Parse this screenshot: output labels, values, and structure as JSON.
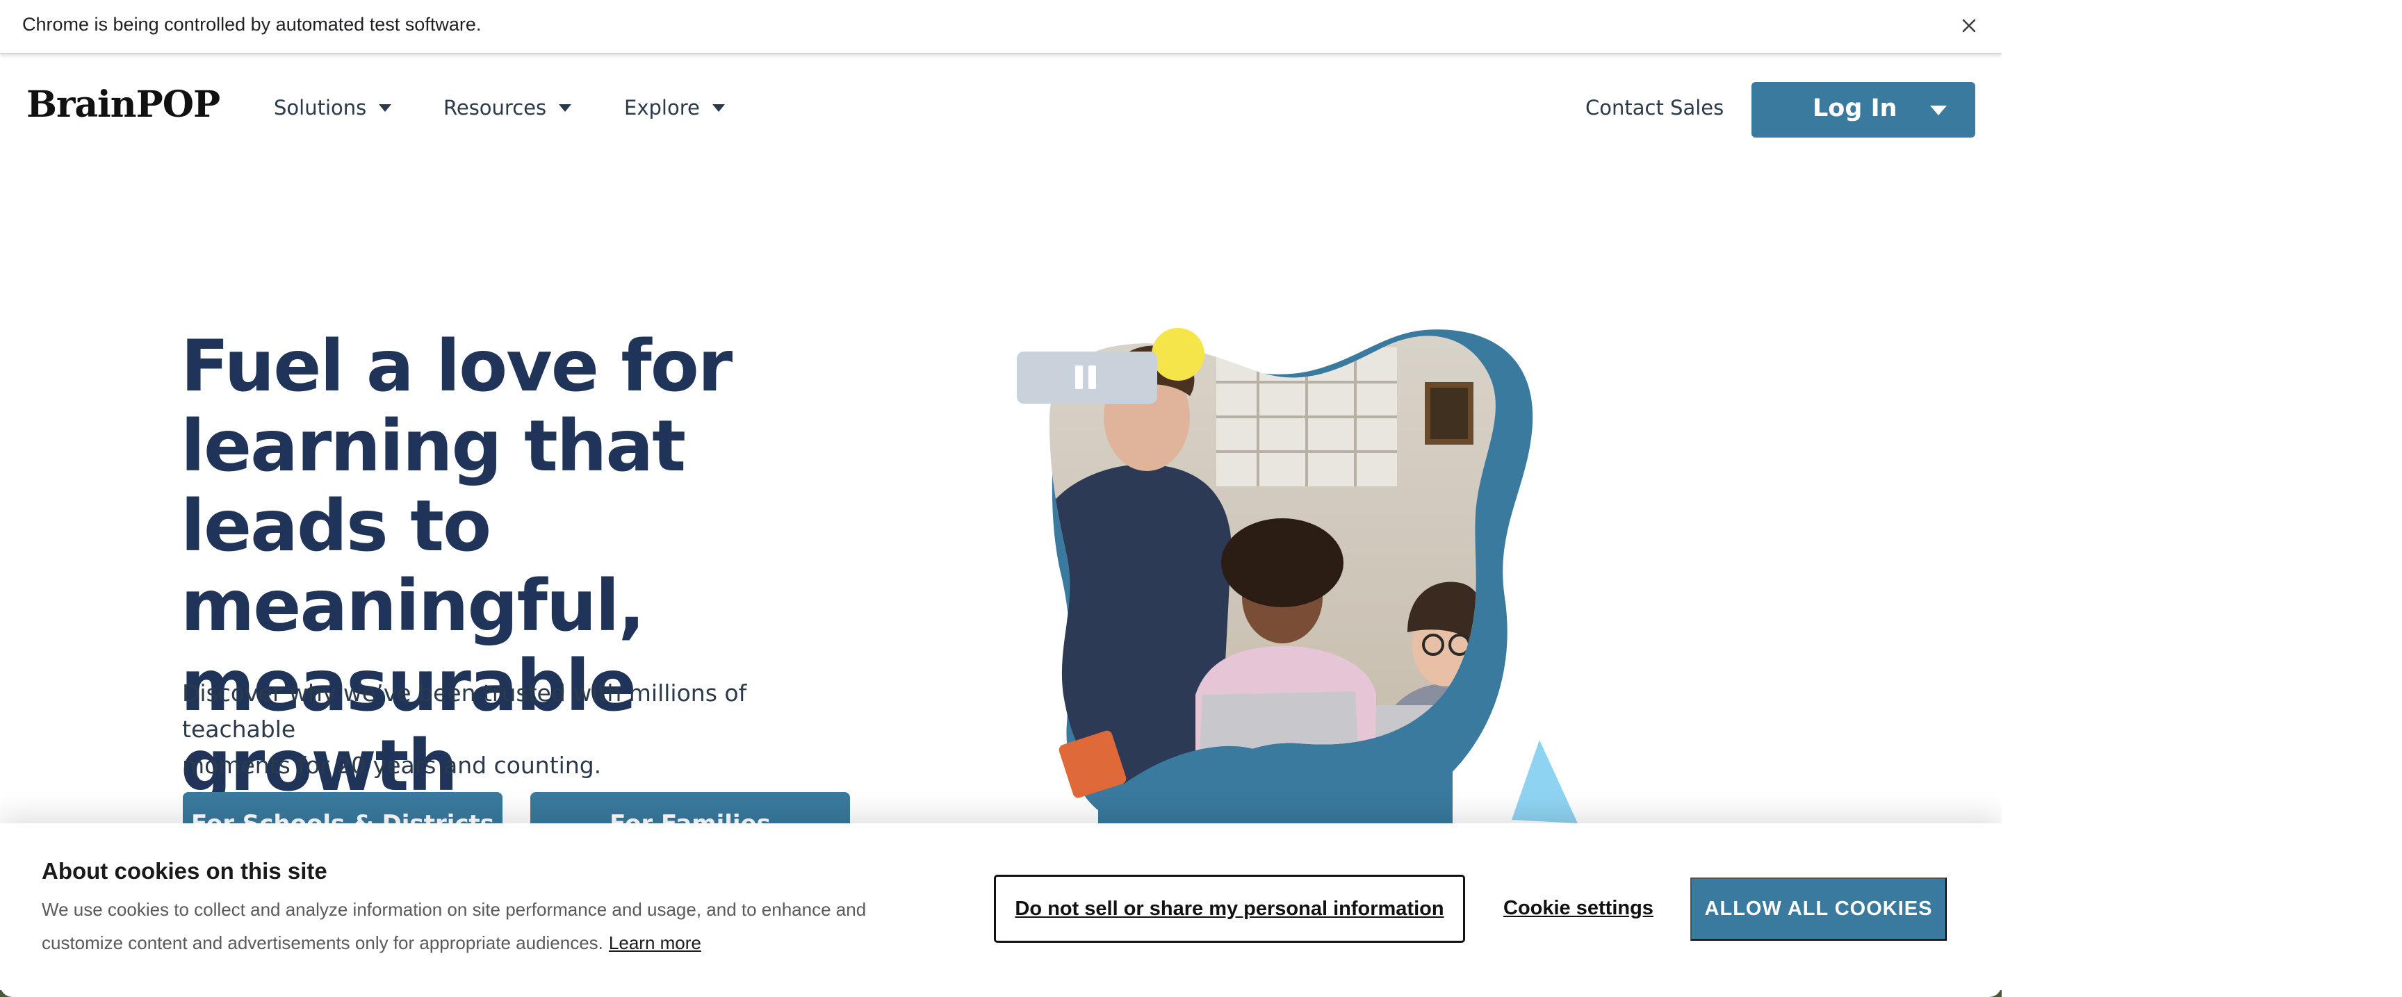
{
  "infobar": {
    "message": "Chrome is being controlled by automated test software.",
    "close_icon": "close-icon"
  },
  "navbar": {
    "logo": "BrainPOP",
    "items": [
      {
        "label": "Solutions",
        "icon": "caret-down-icon"
      },
      {
        "label": "Resources",
        "icon": "caret-down-icon"
      },
      {
        "label": "Explore",
        "icon": "caret-down-icon"
      }
    ],
    "contact_sales": "Contact Sales",
    "login_label": "Log In"
  },
  "hero": {
    "title_lines": [
      "Fuel a love for",
      "learning that leads to",
      "meaningful,",
      "measurable growth"
    ],
    "subtitle_lines": [
      "Discover why we’ve been trusted with millions of teachable",
      "moments for 20 years and counting."
    ],
    "buttons": [
      {
        "label": "For Schools & Districts"
      },
      {
        "label": "For Families"
      }
    ],
    "media": {
      "pause_icon": "pause-icon",
      "image_content": "teacher leaning over two students using laptops"
    }
  },
  "cookie_banner": {
    "title": "About cookies on this site",
    "text_line1": "We use cookies to collect and analyze information on site performance and usage, and to enhance and",
    "text_line2": "customize content and advertisements only for appropriate audiences.",
    "learn_more": "Learn more",
    "do_not_sell": "Do not sell or share my personal information",
    "settings": "Cookie settings",
    "allow_all": "ALLOW ALL COOKIES"
  },
  "colors": {
    "brand_teal": "#3a7a9e",
    "heading_navy": "#1f3458",
    "accent_yellow": "#f5e44a",
    "accent_orange": "#e0693a",
    "accent_lightblue": "#8fd3f2"
  }
}
